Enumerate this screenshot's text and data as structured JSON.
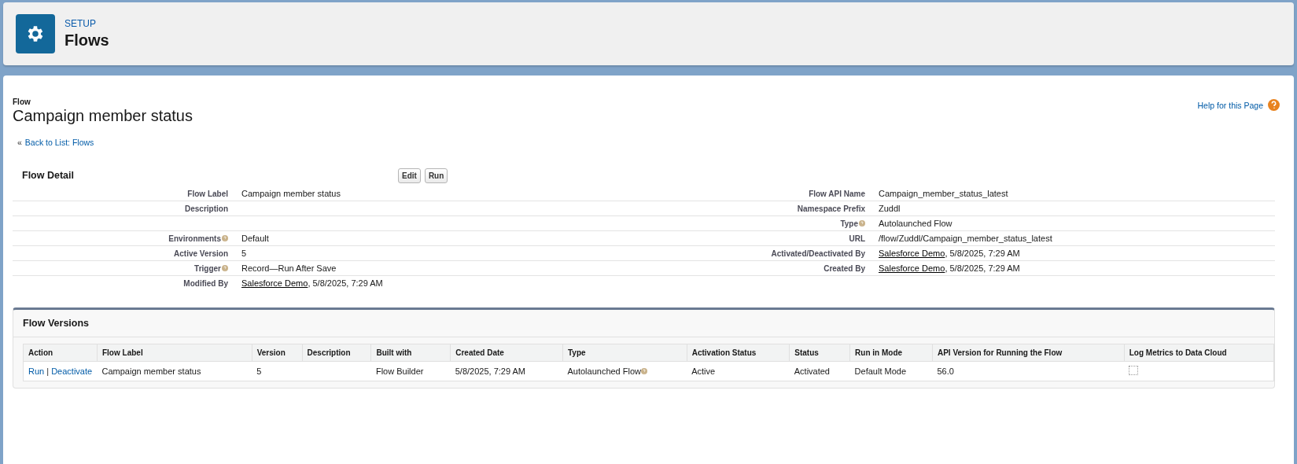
{
  "header": {
    "eyebrow": "SETUP",
    "title": "Flows"
  },
  "page": {
    "type_label": "Flow",
    "title": "Campaign member status",
    "help_link": "Help for this Page",
    "back_prefix": "«",
    "back_link": "Back to List: Flows"
  },
  "detail": {
    "title": "Flow Detail",
    "buttons": [
      "Edit",
      "Run"
    ],
    "rows": [
      {
        "left": {
          "label": "Flow Label",
          "value": "Campaign member status"
        },
        "right": {
          "label": "Flow API Name",
          "value": "Campaign_member_status_latest"
        }
      },
      {
        "left": {
          "label": "Description"
        },
        "right": {
          "label": "Namespace Prefix",
          "value": "Zuddl"
        }
      },
      {
        "right": {
          "label": "Type",
          "help": true,
          "value": "Autolaunched Flow"
        }
      },
      {
        "left": {
          "label": "Environments",
          "help": true,
          "value": "Default"
        },
        "right": {
          "label": "URL",
          "value": "/flow/Zuddl/Campaign_member_status_latest"
        }
      },
      {
        "left": {
          "label": "Active Version",
          "value": "5"
        },
        "right": {
          "label": "Activated/Deactivated By",
          "user": "Salesforce Demo",
          "value": ", 5/8/2025, 7:29 AM"
        }
      },
      {
        "left": {
          "label": "Trigger",
          "help": true,
          "value": "Record—Run After Save"
        },
        "right": {
          "label": "Created By",
          "user": "Salesforce Demo",
          "value": ", 5/8/2025, 7:29 AM"
        }
      },
      {
        "left": {
          "label": "Modified By",
          "user": "Salesforce Demo",
          "value": ", 5/8/2025, 7:29 AM"
        }
      }
    ]
  },
  "versions": {
    "title": "Flow Versions",
    "columns": [
      "Action",
      "Flow Label",
      "Version",
      "Description",
      "Built with",
      "Created Date",
      "Type",
      "Activation Status",
      "Status",
      "Run in Mode",
      "API Version for Running the Flow",
      "Log Metrics to Data Cloud"
    ],
    "rows": [
      {
        "actions": [
          "Run",
          "Deactivate"
        ],
        "separator": "|",
        "flow_label": "Campaign member status",
        "version": "5",
        "built_with": "Flow Builder",
        "created_date": "5/8/2025, 7:29 AM",
        "type": "Autolaunched Flow",
        "activation_status": "Active",
        "status": "Activated",
        "run_in_mode": "Default Mode",
        "api_version": "56.0",
        "log_metrics": {
          "checked": false
        }
      }
    ]
  }
}
